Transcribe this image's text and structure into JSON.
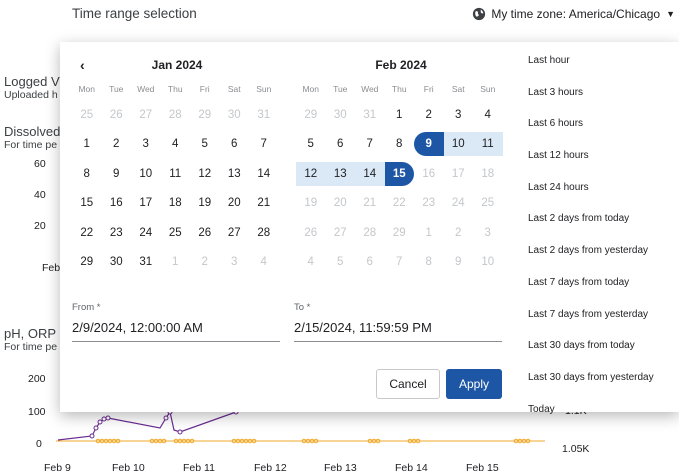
{
  "background": {
    "section1_title": "Logged V",
    "section1_sub": "Uploaded h",
    "section2_title": "Dissolved",
    "section2_sub": "For time pe",
    "y1_ticks": [
      "60",
      "40",
      "20"
    ],
    "x1_tick": "Feb",
    "section3_title": "pH, ORP a",
    "section3_sub": "For time pe",
    "y2_ticks": [
      "200",
      "100",
      "0"
    ],
    "right_ticks": [
      "1.1K",
      "1.05K"
    ],
    "x_ticks": [
      "Feb 9",
      "Feb 10",
      "Feb 11",
      "Feb 12",
      "Feb 13",
      "Feb 14",
      "Feb 15"
    ],
    "colors": {
      "purple": "#6a2c91",
      "orange": "#f0a828"
    }
  },
  "dialog": {
    "title": "Time range selection",
    "timezone": "My time zone: America/Chicago",
    "prev_icon": "chevron-left-icon",
    "weekdays": [
      "Mon",
      "Tue",
      "Wed",
      "Thu",
      "Fri",
      "Sat",
      "Sun"
    ],
    "months": [
      {
        "title": "Jan 2024",
        "weeks": [
          [
            "25",
            "26",
            "27",
            "28",
            "29",
            "30",
            "31"
          ],
          [
            "1",
            "2",
            "3",
            "4",
            "5",
            "6",
            "7"
          ],
          [
            "8",
            "9",
            "10",
            "11",
            "12",
            "13",
            "14"
          ],
          [
            "15",
            "16",
            "17",
            "18",
            "19",
            "20",
            "21"
          ],
          [
            "22",
            "23",
            "24",
            "25",
            "26",
            "27",
            "28"
          ],
          [
            "29",
            "30",
            "31",
            "1",
            "2",
            "3",
            "4"
          ]
        ]
      },
      {
        "title": "Feb 2024",
        "weeks": [
          [
            "29",
            "30",
            "31",
            "1",
            "2",
            "3",
            "4"
          ],
          [
            "5",
            "6",
            "7",
            "8",
            "9",
            "10",
            "11"
          ],
          [
            "12",
            "13",
            "14",
            "15",
            "16",
            "17",
            "18"
          ],
          [
            "19",
            "20",
            "21",
            "22",
            "23",
            "24",
            "25"
          ],
          [
            "26",
            "27",
            "28",
            "29",
            "1",
            "2",
            "3"
          ],
          [
            "4",
            "5",
            "6",
            "7",
            "8",
            "9",
            "10"
          ]
        ]
      }
    ],
    "from_label": "From *",
    "from_value": "2/9/2024, 12:00:00 AM",
    "to_label": "To *",
    "to_value": "2/15/2024, 11:59:59 PM",
    "cancel_label": "Cancel",
    "apply_label": "Apply",
    "presets": [
      "Last hour",
      "Last 3 hours",
      "Last 6 hours",
      "Last 12 hours",
      "Last 24 hours",
      "Last 2 days from today",
      "Last 2 days from yesterday",
      "Last 7 days from today",
      "Last 7 days from yesterday",
      "Last 30 days from today",
      "Last 30 days from yesterday",
      "Today"
    ],
    "accent": "#1d56a5",
    "range_color": "#dbe8f6"
  }
}
